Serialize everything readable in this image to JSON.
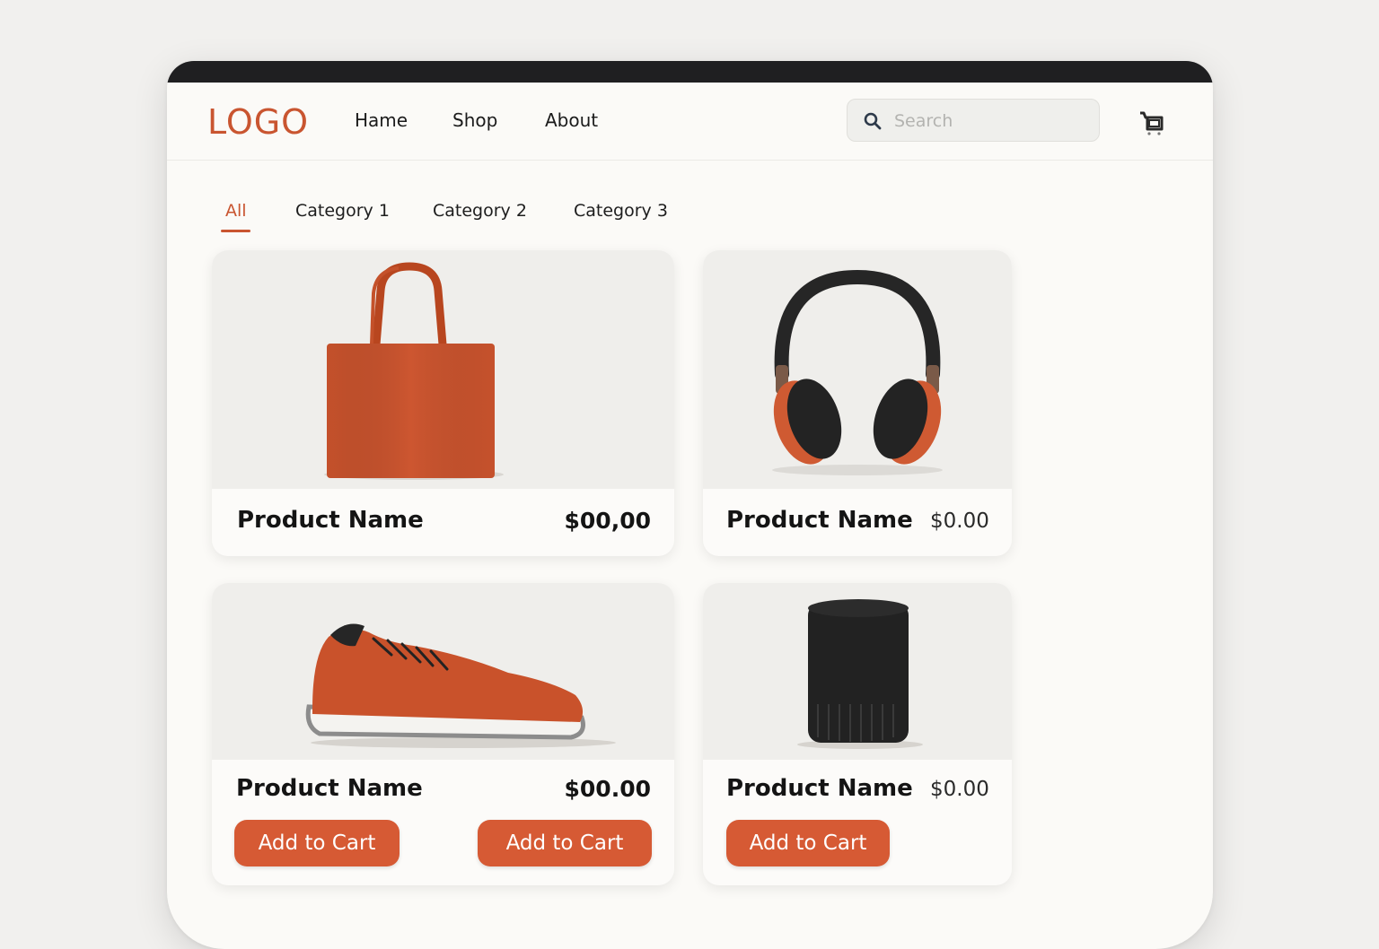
{
  "header": {
    "logo": "LOGO",
    "nav": [
      "Hame",
      "Shop",
      "About"
    ],
    "search_placeholder": "Search",
    "cart_icon": "cart-icon",
    "search_icon": "search-icon"
  },
  "tabs": {
    "items": [
      "All",
      "Category 1",
      "Category 2",
      "Category 3"
    ],
    "active": "All"
  },
  "products": [
    {
      "name": "Product Name",
      "price": "$00,00",
      "image": "tote-bag"
    },
    {
      "name": "Product Name",
      "price": "$0.00",
      "image": "headphones"
    },
    {
      "name": "Product Name",
      "price": "$00.00",
      "image": "sneaker",
      "button": "Add to Cart"
    },
    {
      "name": "Product Name",
      "price": "$0.00",
      "image": "speaker",
      "button": "Add to Cart"
    }
  ],
  "extra_button": "Add to Cart",
  "colors": {
    "accent": "#d65a34",
    "logo": "#c95530",
    "titlebar": "#1f1f21",
    "background": "#f1f0ee",
    "window": "#fbfaf7"
  }
}
